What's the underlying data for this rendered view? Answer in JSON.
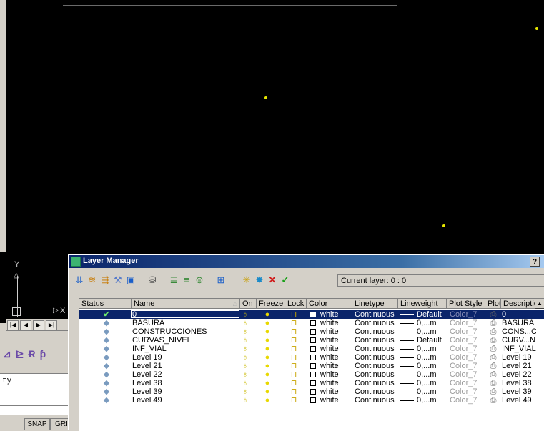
{
  "canvas": {
    "background": "#000000",
    "ucs": {
      "y_label": "Y",
      "x_label": "X"
    }
  },
  "tabnav": {
    "buttons": [
      "|◀",
      "◀",
      "▶",
      "▶|"
    ]
  },
  "command": {
    "text": "ty"
  },
  "statusbar": {
    "snap": "SNAP",
    "grid": "GRI"
  },
  "layer_manager": {
    "title": "Layer Manager",
    "help": "?",
    "current_layer": "Current layer: 0 : 0",
    "columns": [
      "Status",
      "Name",
      "On",
      "Freeze",
      "Lock",
      "Color",
      "Linetype",
      "Lineweight",
      "Plot Style",
      "Plot",
      "Descriptic"
    ],
    "rows": [
      {
        "name": "0",
        "color": "white",
        "linetype": "Continuous",
        "lineweight": "Default",
        "plot_style": "Color_7",
        "description": "0",
        "current": true
      },
      {
        "name": "BASURA",
        "color": "white",
        "linetype": "Continuous",
        "lineweight": "0,...m",
        "plot_style": "Color_7",
        "description": "BASURA",
        "current": false
      },
      {
        "name": "CONSTRUCCIONES",
        "color": "white",
        "linetype": "Continuous",
        "lineweight": "0,...m",
        "plot_style": "Color_7",
        "description": "CONS...C",
        "current": false
      },
      {
        "name": "CURVAS_NIVEL",
        "color": "white",
        "linetype": "Continuous",
        "lineweight": "Default",
        "plot_style": "Color_7",
        "description": "CURV...N",
        "current": false
      },
      {
        "name": "INF_VIAL",
        "color": "white",
        "linetype": "Continuous",
        "lineweight": "0,...m",
        "plot_style": "Color_7",
        "description": "INF_VIAL",
        "current": false
      },
      {
        "name": "Level 19",
        "color": "white",
        "linetype": "Continuous",
        "lineweight": "0,...m",
        "plot_style": "Color_7",
        "description": "Level 19",
        "current": false
      },
      {
        "name": "Level 21",
        "color": "white",
        "linetype": "Continuous",
        "lineweight": "0,...m",
        "plot_style": "Color_7",
        "description": "Level 21",
        "current": false
      },
      {
        "name": "Level 22",
        "color": "white",
        "linetype": "Continuous",
        "lineweight": "0,...m",
        "plot_style": "Color_7",
        "description": "Level 22",
        "current": false
      },
      {
        "name": "Level 38",
        "color": "white",
        "linetype": "Continuous",
        "lineweight": "0,...m",
        "plot_style": "Color_7",
        "description": "Level 38",
        "current": false
      },
      {
        "name": "Level 39",
        "color": "white",
        "linetype": "Continuous",
        "lineweight": "0,...m",
        "plot_style": "Color_7",
        "description": "Level 39",
        "current": false
      },
      {
        "name": "Level 49",
        "color": "white",
        "linetype": "Continuous",
        "lineweight": "0,...m",
        "plot_style": "Color_7",
        "description": "Level 49",
        "current": false
      }
    ]
  }
}
